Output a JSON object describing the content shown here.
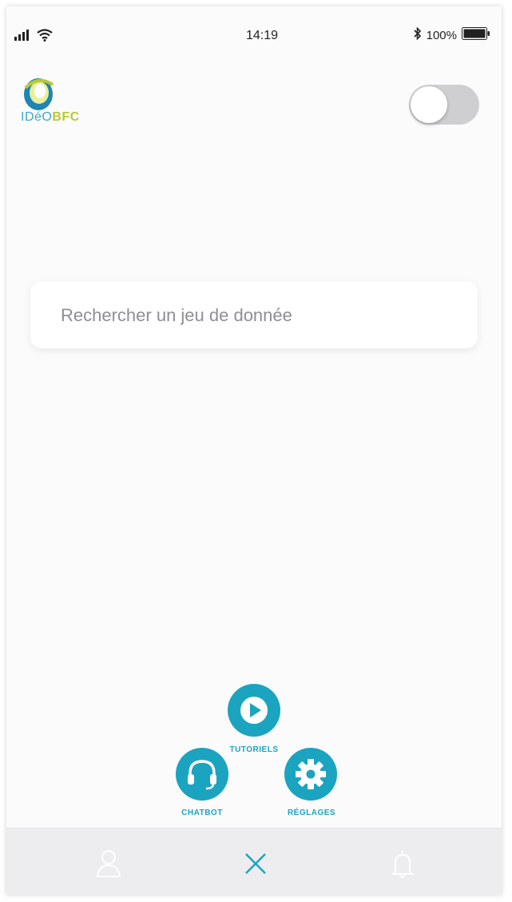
{
  "status_bar": {
    "time": "14:19",
    "battery": "100%",
    "icons": [
      "signal-icon",
      "wifi-icon",
      "bluetooth-icon",
      "battery-icon"
    ]
  },
  "header": {
    "logo": {
      "text_light": "IDéO",
      "text_bold": "BFC"
    },
    "toggle": {
      "state": "off"
    }
  },
  "search": {
    "placeholder": "Rechercher un jeu de donnée"
  },
  "fab_menu": {
    "tutoriels_label": "TUTORIELS",
    "chatbot_label": "CHATBOT",
    "reglages_label": "RÉGLAGES"
  },
  "tab_bar": {
    "items": [
      "profile-icon",
      "close-icon",
      "bell-icon"
    ]
  },
  "colors": {
    "accent": "#1ba4bf",
    "logo_blue": "#3fa8c6",
    "logo_green": "#b8c934",
    "tabbar_bg": "#ededef"
  }
}
